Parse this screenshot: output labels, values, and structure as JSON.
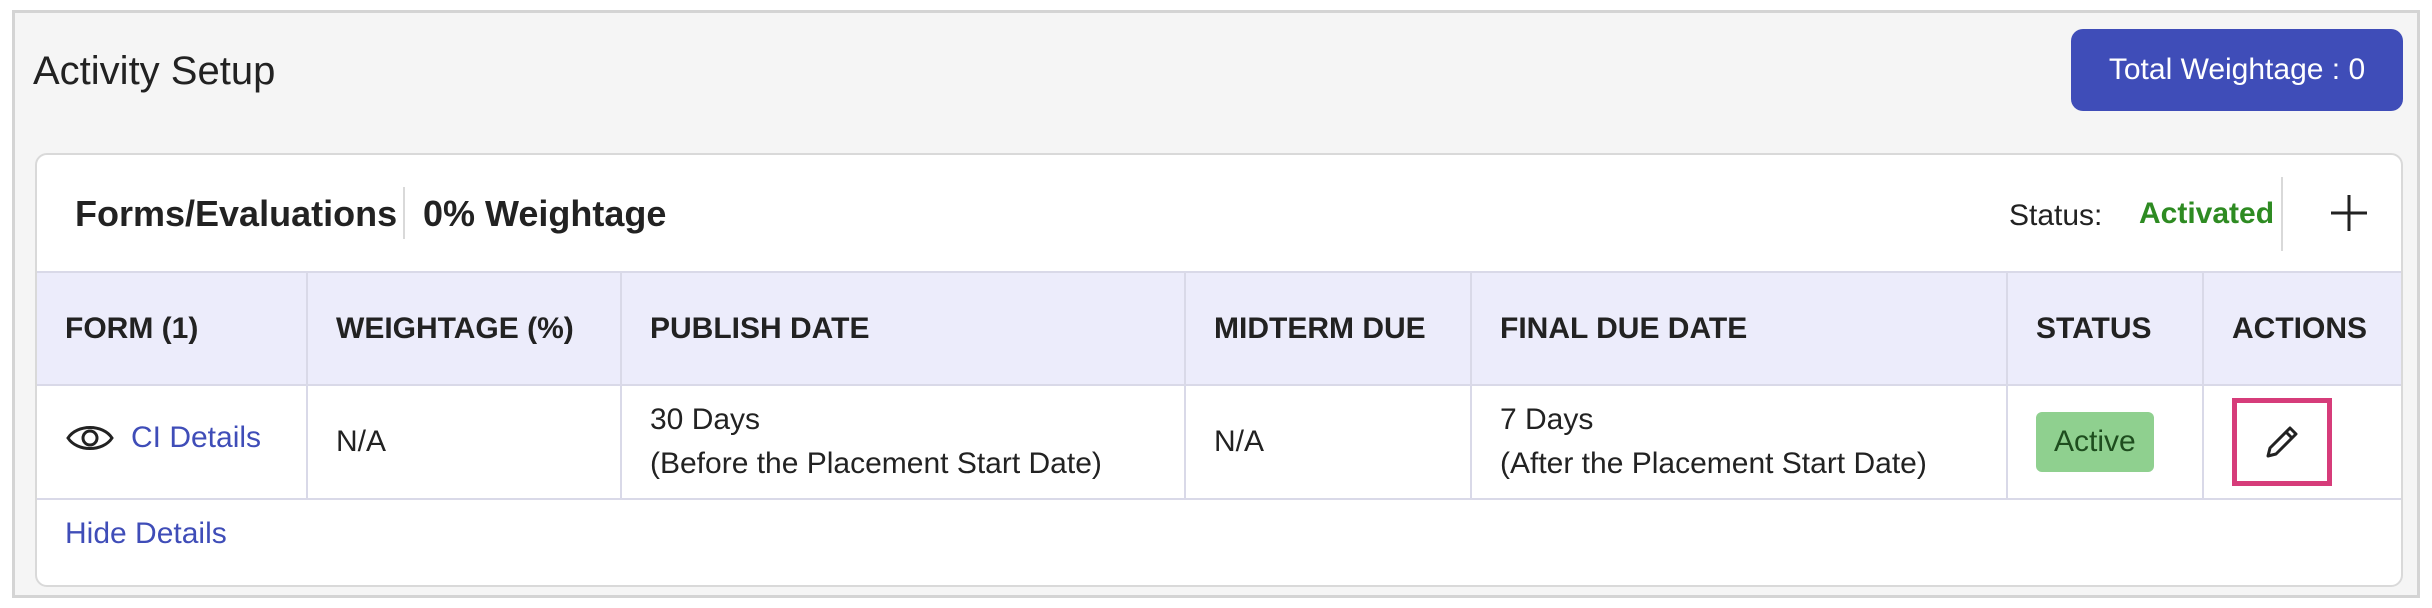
{
  "page": {
    "title": "Activity Setup",
    "total_weightage_label": "Total Weightage : 0"
  },
  "section": {
    "title": "Forms/Evaluations",
    "weightage": "0% Weightage",
    "status_label": "Status:",
    "status_value": "Activated",
    "add_icon": "plus-icon"
  },
  "table": {
    "columns": [
      "FORM (1)",
      "WEIGHTAGE (%)",
      "PUBLISH DATE",
      "MIDTERM DUE",
      "FINAL DUE DATE",
      "STATUS",
      "ACTIONS"
    ],
    "rows": [
      {
        "form_icon": "eye-icon",
        "form_name": "CI Details",
        "weightage": "N/A",
        "publish_line1": "30 Days",
        "publish_line2": "(Before the Placement Start Date)",
        "midterm_due": "N/A",
        "final_line1": "7 Days",
        "final_line2": "(After the Placement Start Date)",
        "status": "Active",
        "action_icon": "pencil-icon"
      }
    ]
  },
  "footer": {
    "toggle_label": "Hide Details"
  },
  "colors": {
    "primary": "#3f4db8",
    "status_green": "#2e8b22",
    "badge_green": "#8fd08f",
    "header_bg": "#ececfb",
    "highlight_border": "#d63c7a"
  }
}
